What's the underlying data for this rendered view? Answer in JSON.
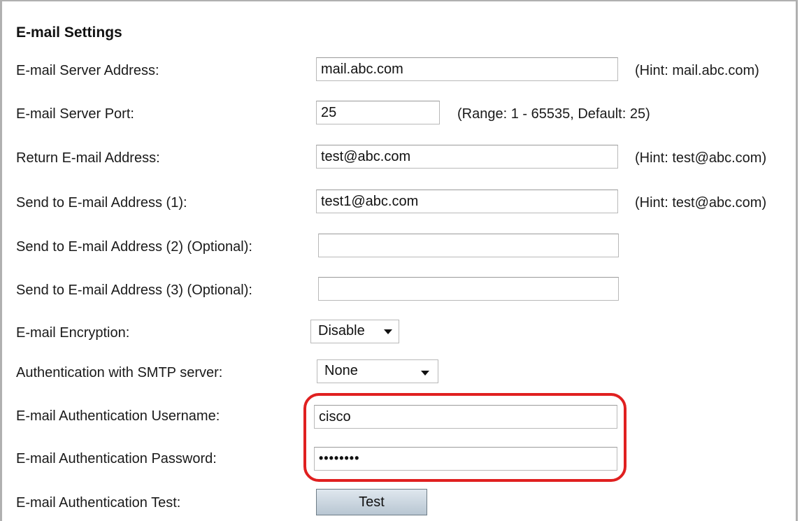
{
  "section": {
    "title": "E-mail Settings"
  },
  "fields": {
    "server_address": {
      "label": "E-mail Server Address:",
      "value": "mail.abc.com",
      "hint": "(Hint: mail.abc.com)"
    },
    "server_port": {
      "label": "E-mail Server Port:",
      "value": "25",
      "hint": "(Range: 1 - 65535, Default: 25)"
    },
    "return_address": {
      "label": "Return E-mail Address:",
      "value": "test@abc.com",
      "hint": "(Hint: test@abc.com)"
    },
    "send_to_1": {
      "label": "Send to E-mail Address (1):",
      "value": "test1@abc.com",
      "hint": "(Hint: test@abc.com)"
    },
    "send_to_2": {
      "label": "Send to E-mail Address (2) (Optional):",
      "value": ""
    },
    "send_to_3": {
      "label": "Send to E-mail Address (3) (Optional):",
      "value": ""
    },
    "encryption": {
      "label": "E-mail Encryption:",
      "selected": "Disable"
    },
    "smtp_auth": {
      "label": "Authentication with SMTP server:",
      "selected": "None"
    },
    "auth_username": {
      "label": "E-mail Authentication Username:",
      "value": "cisco"
    },
    "auth_password": {
      "label": "E-mail Authentication Password:",
      "masked_value": "••••••••"
    },
    "auth_test": {
      "label": "E-mail Authentication Test:",
      "button_label": "Test"
    }
  },
  "colors": {
    "highlight": "#e02020",
    "button_gradient_top": "#dfe7ee",
    "button_gradient_bottom": "#b8c6d2"
  },
  "icons": {
    "dropdown": "chevron-down-icon"
  }
}
